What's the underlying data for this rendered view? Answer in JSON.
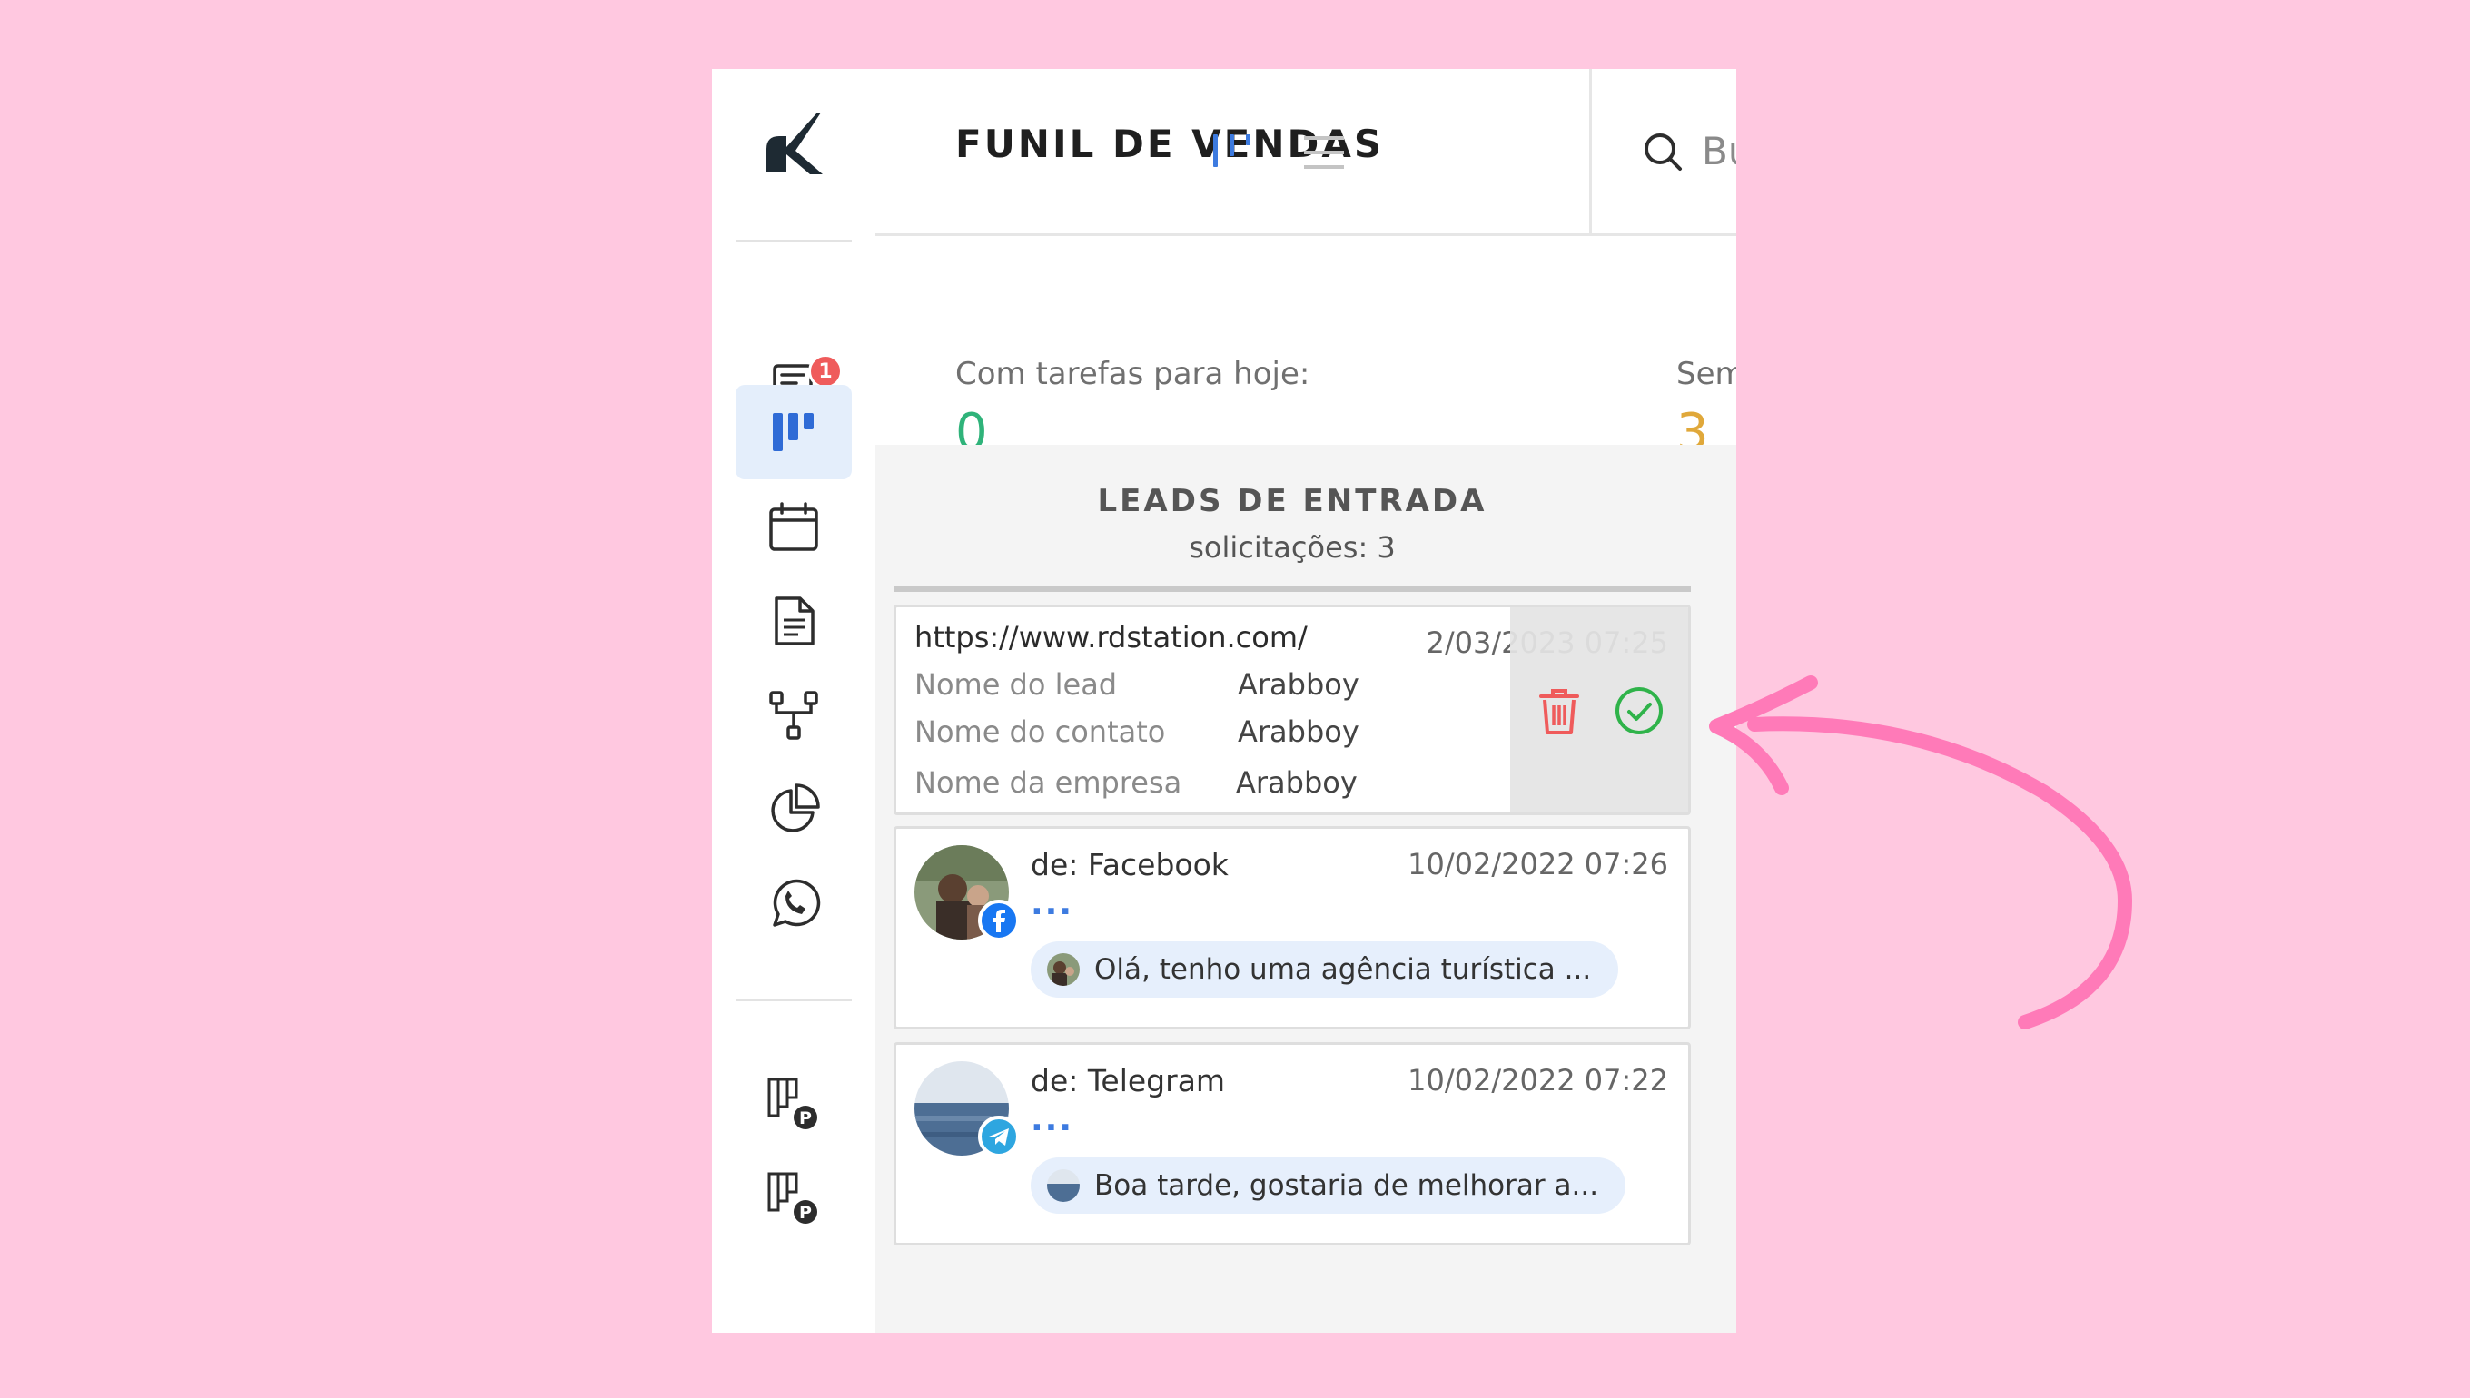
{
  "app": {
    "title": "FUNIL DE VENDAS",
    "search_placeholder": "Bu",
    "accent": "#3d7be0"
  },
  "sidebar": {
    "chat_badge": "1",
    "items": [
      {
        "icon": "chat-icon"
      },
      {
        "icon": "kanban-icon",
        "active": true
      },
      {
        "icon": "calendar-icon"
      },
      {
        "icon": "document-icon"
      },
      {
        "icon": "workflow-icon"
      },
      {
        "icon": "pie-chart-icon"
      },
      {
        "icon": "whatsapp-icon"
      },
      {
        "icon": "pipeline-p-icon"
      },
      {
        "icon": "pipeline-p-icon"
      }
    ]
  },
  "stats": {
    "today_label": "Com tarefas para hoje:",
    "today_value": "0",
    "today_color": "#2fb37a",
    "without_label": "Sem",
    "without_value": "3",
    "without_color": "#e0a83a"
  },
  "column": {
    "title": "LEADS DE ENTRADA",
    "subtitle": "solicitações: 3"
  },
  "leads": {
    "form_lead": {
      "url": "https://www.rdstation.com/",
      "date": "2/03/2023 07:25",
      "fields": [
        {
          "label": "Nome do lead",
          "value": "Arabboy"
        },
        {
          "label": "Nome do contato",
          "value": "Arabboy"
        },
        {
          "label": "Nome da empresa",
          "value": "Arabboy"
        }
      ]
    },
    "facebook": {
      "from": "de: Facebook",
      "date": "10/02/2022 07:26",
      "dots": "...",
      "message": "Olá, tenho uma agência turística ..."
    },
    "telegram": {
      "from": "de: Telegram",
      "date": "10/02/2022 07:22",
      "dots": "...",
      "message": "Boa tarde, gostaria de melhorar a..."
    }
  },
  "annotation": {
    "arrow_color": "#ff7ab8"
  }
}
